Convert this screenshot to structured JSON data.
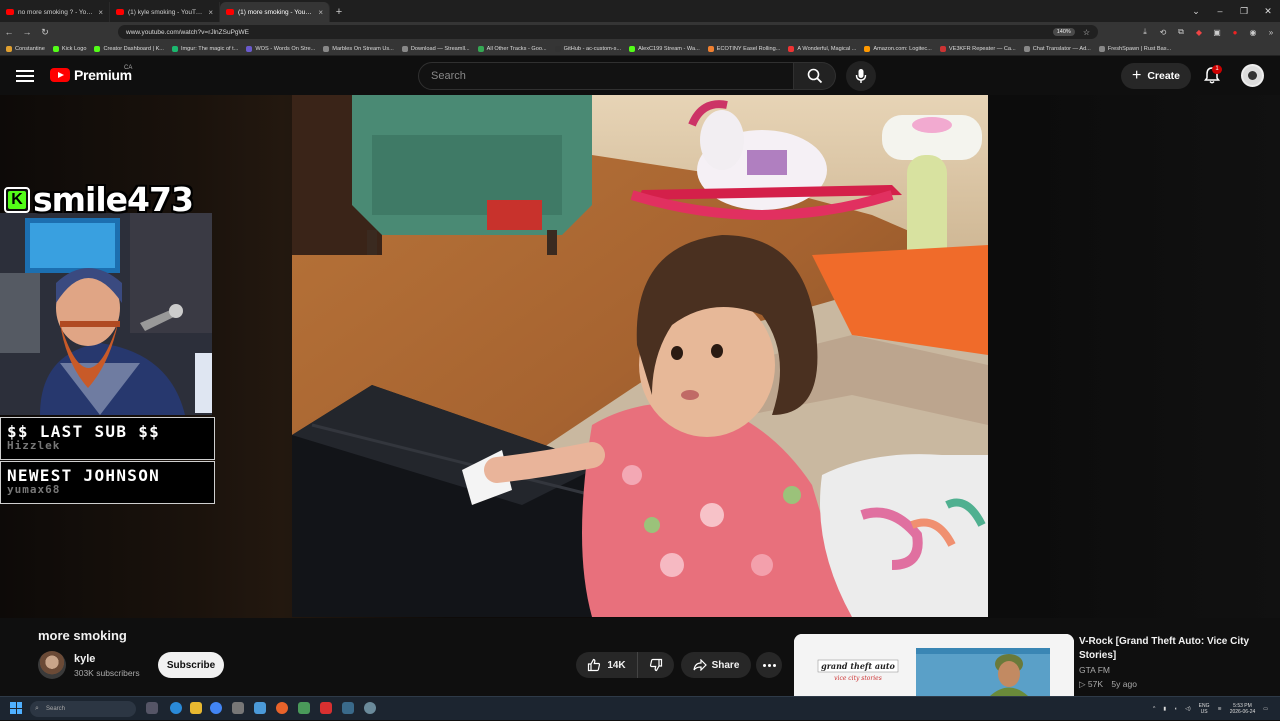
{
  "browser": {
    "tabs": [
      {
        "title": "no more smoking ? - YouTube"
      },
      {
        "title": "(1) kyle smoking - YouTube"
      },
      {
        "title": "(1) more smoking - YouTube"
      }
    ],
    "active_tab": 2,
    "url": "www.youtube.com/watch?v=rJlnZSuPgWE",
    "zoom": "140%",
    "bookmarks": [
      "Constantine",
      "Kick Logo",
      "Creator Dashboard | K...",
      "Imgur: The magic of t...",
      "WOS - Words On Stre...",
      "Marbles On Stream Us...",
      "Download — Streamll...",
      "All Other Tracks - Goo...",
      "GitHub - ac-custom-s...",
      "AlexC199 Stream - Wa...",
      "ECOTINY Easel Rolling...",
      "A Wonderful, Magical ...",
      "Amazon.com: Logitec...",
      "VE3KFR Repeater — Ca...",
      "Chat Translator — Ad...",
      "FreshSpawn | Rust Bas..."
    ]
  },
  "youtube": {
    "logo_text": "Premium",
    "region": "CA",
    "search_placeholder": "Search",
    "create_label": "Create",
    "notification_count": "1",
    "colors": {
      "brand": "#ff0000",
      "background": "#0f0f0f",
      "kick_green": "#53fc18"
    }
  },
  "overlay": {
    "streamer_name": "smile473",
    "last_sub_label": "$$ LAST SUB $$",
    "last_sub_name": "Hizzlek",
    "newest_label": "NEWEST JOHNSON",
    "newest_name": "yumax68"
  },
  "video": {
    "title": "more smoking",
    "channel": "kyle",
    "subscribers": "303K subscribers",
    "subscribe_label": "Subscribe",
    "likes": "14K",
    "share_label": "Share"
  },
  "recommended": {
    "title": "V-Rock [Grand Theft Auto: Vice City Stories]",
    "channel": "GTA FM",
    "views": "57K",
    "age": "5y ago"
  },
  "taskbar": {
    "search_placeholder": "Search",
    "lang_top": "ENG",
    "lang_bottom": "US",
    "time": "5:53 PM",
    "date": "2026-06-24"
  }
}
